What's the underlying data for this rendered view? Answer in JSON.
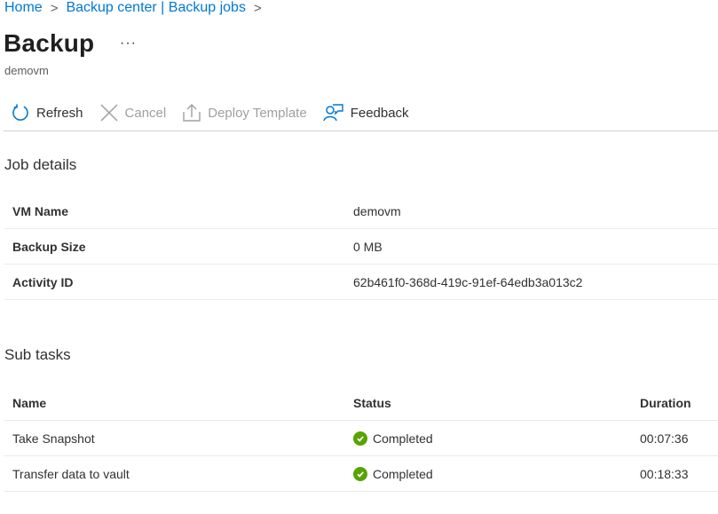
{
  "breadcrumb": {
    "items": [
      "Home",
      "Backup center | Backup jobs"
    ]
  },
  "header": {
    "title": "Backup",
    "more_label": "···",
    "subtitle": "demovm"
  },
  "toolbar": {
    "refresh_label": "Refresh",
    "cancel_label": "Cancel",
    "deploy_label": "Deploy Template",
    "feedback_label": "Feedback"
  },
  "job_details": {
    "title": "Job details",
    "rows": [
      {
        "key": "VM Name",
        "value": "demovm"
      },
      {
        "key": "Backup Size",
        "value": "0 MB"
      },
      {
        "key": "Activity ID",
        "value": "62b461f0-368d-419c-91ef-64edb3a013c2"
      }
    ]
  },
  "sub_tasks": {
    "title": "Sub tasks",
    "columns": [
      "Name",
      "Status",
      "Duration"
    ],
    "rows": [
      {
        "name": "Take Snapshot",
        "status": "Completed",
        "duration": "00:07:36"
      },
      {
        "name": "Transfer data to vault",
        "status": "Completed",
        "duration": "00:18:33"
      }
    ]
  },
  "colors": {
    "accent": "#0078d4",
    "success": "#57a300",
    "disabled": "#a19f9d"
  }
}
